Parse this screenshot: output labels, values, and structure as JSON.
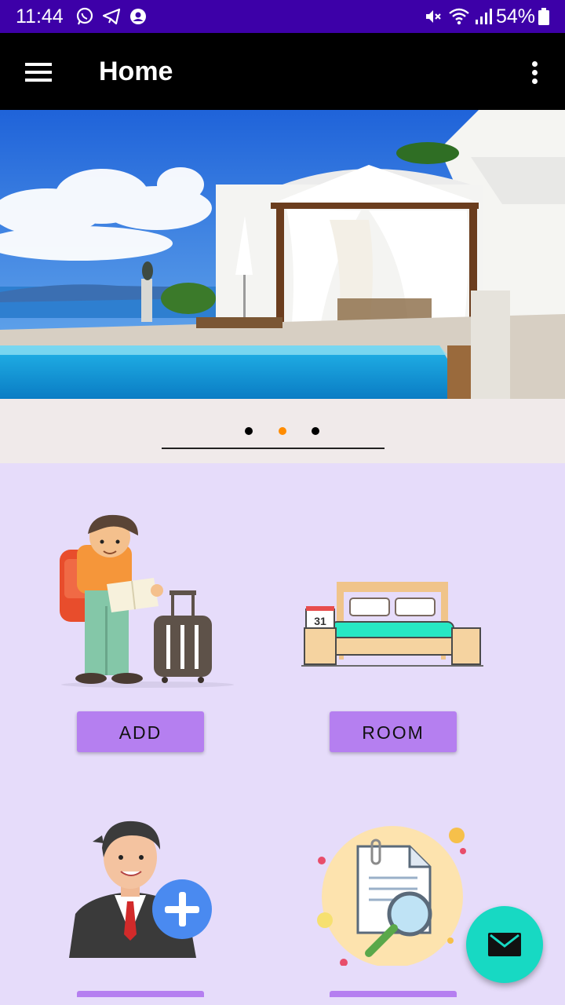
{
  "status_bar": {
    "time": "11:44",
    "battery_percent": "54%",
    "icons": [
      "whatsapp-icon",
      "telegram-icon",
      "account-icon",
      "mute-icon",
      "wifi-icon",
      "signal-icon",
      "battery-icon"
    ],
    "background": "#3d00a8"
  },
  "toolbar": {
    "title": "Home",
    "background": "#000000"
  },
  "carousel": {
    "page_count": 3,
    "active_page": 2,
    "active_color": "#ff8c00",
    "inactive_color": "#000000"
  },
  "tiles": [
    {
      "button_label": "ADD",
      "image": "traveler-illustration"
    },
    {
      "button_label": "ROOM",
      "image": "bed-illustration"
    },
    {
      "button_label": "",
      "image": "add-person-illustration"
    },
    {
      "button_label": "",
      "image": "search-document-illustration"
    }
  ],
  "fab": {
    "icon": "mail-icon",
    "color": "#17d9c3"
  },
  "colors": {
    "page_background": "#e6dcfa",
    "button": "#b57ff0"
  }
}
